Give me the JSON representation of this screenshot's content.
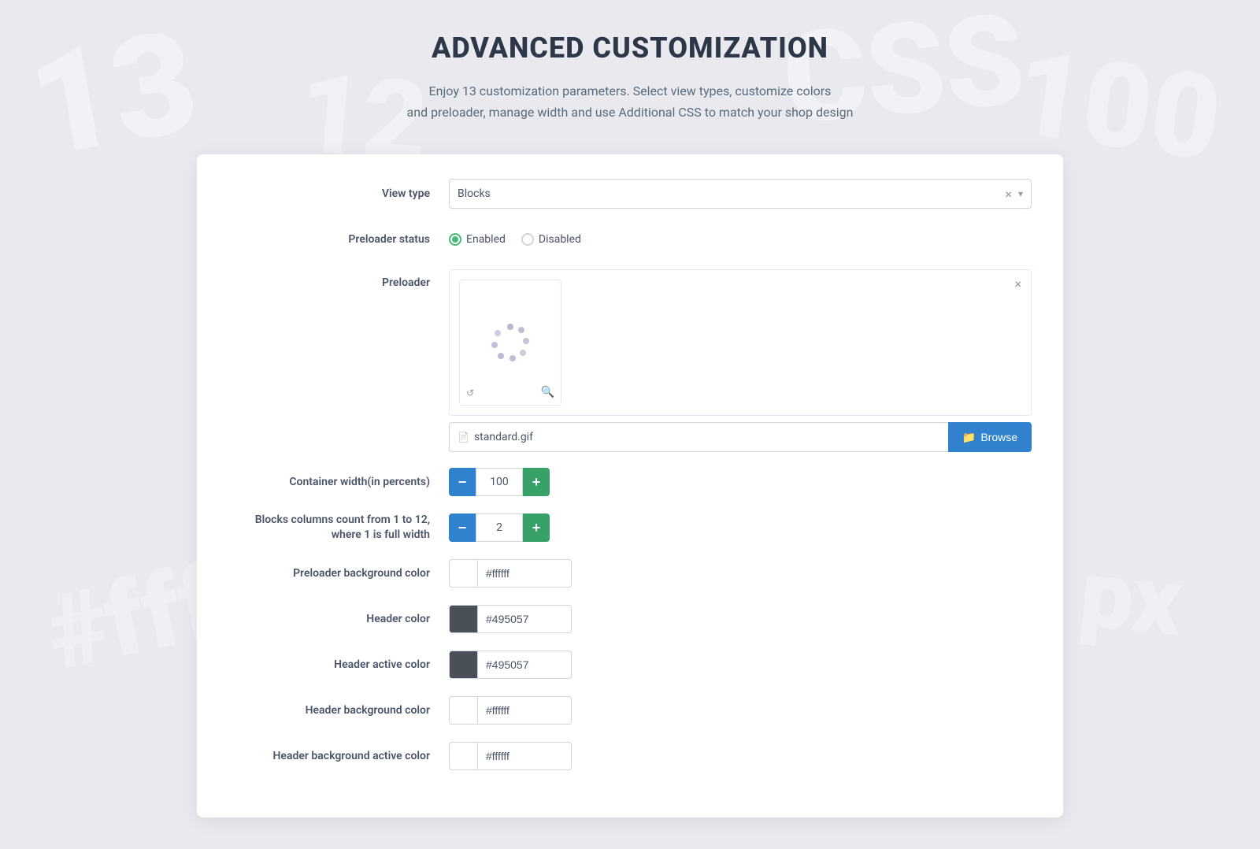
{
  "page": {
    "title": "ADVANCED CUSTOMIZATION",
    "subtitle_line1": "Enjoy 13 customization parameters. Select view types, customize colors",
    "subtitle_line2": "and preloader, manage width and use Additional CSS to match your shop design"
  },
  "form": {
    "view_type_label": "View type",
    "view_type_value": "Blocks",
    "preloader_status_label": "Preloader status",
    "preloader_label": "Preloader",
    "enabled_label": "Enabled",
    "disabled_label": "Disabled",
    "file_name": "standard.gif",
    "browse_label": "Browse",
    "container_width_label": "Container width(in percents)",
    "container_width_value": "100",
    "blocks_columns_label": "Blocks columns count from 1 to 12, where 1 is full width",
    "blocks_columns_value": "2",
    "preloader_bg_label": "Preloader background color",
    "preloader_bg_value": "#ffffff",
    "header_color_label": "Header color",
    "header_color_value": "#495057",
    "header_active_label": "Header active color",
    "header_active_value": "#495057",
    "header_bg_label": "Header background color",
    "header_bg_value": "#ffffff",
    "header_bg_active_label": "Header background active color",
    "header_bg_active_value": "#ffffff"
  },
  "icons": {
    "minus": "−",
    "plus": "+",
    "close": "×",
    "zoom": "🔍",
    "file": "📄",
    "browse_icon": "📁",
    "arrow_down": "▾",
    "corner": "↺"
  }
}
